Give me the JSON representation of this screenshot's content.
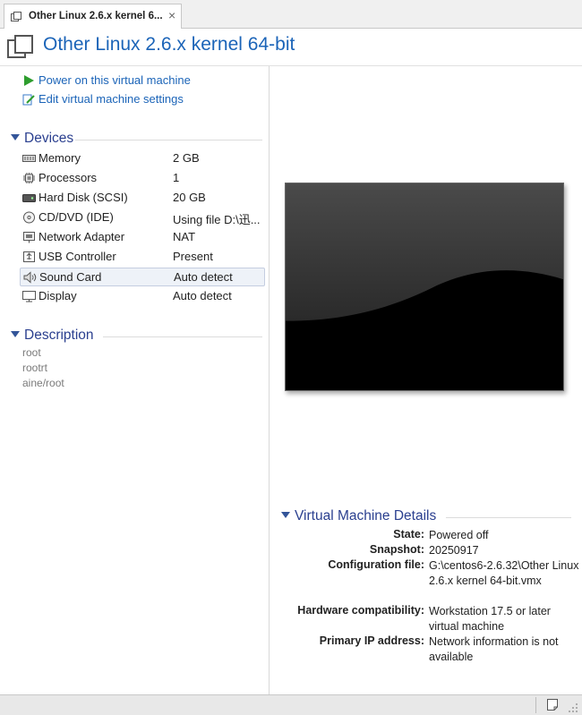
{
  "tab": {
    "title": "Other Linux 2.6.x kernel 6...",
    "close_glyph": "×"
  },
  "vm": {
    "title": "Other Linux 2.6.x kernel 64-bit"
  },
  "actions": [
    {
      "label": "Power on this virtual machine",
      "icon": "play-icon"
    },
    {
      "label": "Edit virtual machine settings",
      "icon": "edit-settings-icon"
    }
  ],
  "devices": {
    "heading": "Devices",
    "items": [
      {
        "name": "Memory",
        "value": "2 GB",
        "icon": "memory-icon"
      },
      {
        "name": "Processors",
        "value": "1",
        "icon": "processor-icon"
      },
      {
        "name": "Hard Disk (SCSI)",
        "value": "20 GB",
        "icon": "hard-disk-icon"
      },
      {
        "name": "CD/DVD (IDE)",
        "value": "Using file D:\\迅...",
        "icon": "cd-dvd-icon"
      },
      {
        "name": "Network Adapter",
        "value": "NAT",
        "icon": "network-adapter-icon"
      },
      {
        "name": "USB Controller",
        "value": "Present",
        "icon": "usb-icon"
      },
      {
        "name": "Sound Card",
        "value": "Auto detect",
        "icon": "sound-card-icon",
        "selected": true
      },
      {
        "name": "Display",
        "value": "Auto detect",
        "icon": "display-icon"
      }
    ]
  },
  "description": {
    "heading": "Description",
    "lines": [
      "root",
      "rootrt",
      "aine/root"
    ]
  },
  "details": {
    "heading": "Virtual Machine Details",
    "state_label": "State:",
    "state_value": "Powered off",
    "snapshot_label": "Snapshot:",
    "snapshot_value": "20250917",
    "config_label": "Configuration file:",
    "config_value": "G:\\centos6-2.6.32\\Other Linux 2.6.x kernel 64-bit.vmx",
    "hw_label": "Hardware compatibility:",
    "hw_value": "Workstation 17.5 or later virtual machine",
    "ip_label": "Primary IP address:",
    "ip_value": "Network information is not available"
  },
  "colors": {
    "accent": "#1b64b8",
    "section": "#2a3f8f",
    "play": "#2e9d2e"
  }
}
